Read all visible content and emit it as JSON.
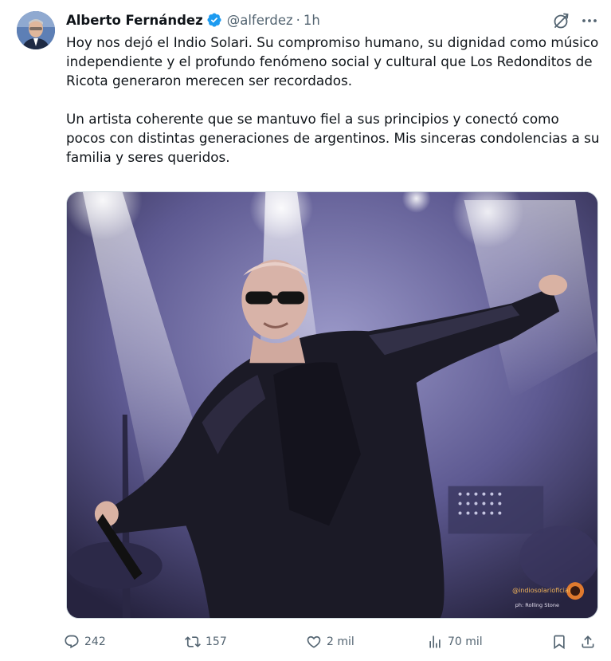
{
  "author": {
    "name": "Alberto Fernández",
    "handle": "@alferdez",
    "separator": "·",
    "time": "1h",
    "verified": true
  },
  "tweet": {
    "paragraphs": [
      "Hoy nos dejó el Indio Solari. Su compromiso humano, su dignidad como músico independiente y el profundo fenómeno social y cultural que Los Redonditos de Ricota generaron merecen ser recordados.",
      "Un artista coherente que se mantuvo fiel a sus principios y conectó como pocos con distintas generaciones de argentinos. Mis sinceras condolencias a su familia y seres queridos."
    ]
  },
  "media": {
    "watermark": "@indiosolarioficial",
    "watermark_sub": "ph: Rolling Stone"
  },
  "actions": {
    "replies": "242",
    "reposts": "157",
    "likes": "2 mil",
    "views": "70 mil"
  },
  "icons": {
    "verified": "verified-badge-icon",
    "grok": "grok-icon",
    "more": "more-options-icon",
    "reply": "reply-icon",
    "repost": "repost-icon",
    "like": "heart-icon",
    "views": "views-icon",
    "bookmark": "bookmark-icon",
    "share": "share-icon"
  },
  "colors": {
    "text": "#0f1419",
    "secondary": "#536471",
    "verified": "#1d9bf0"
  }
}
